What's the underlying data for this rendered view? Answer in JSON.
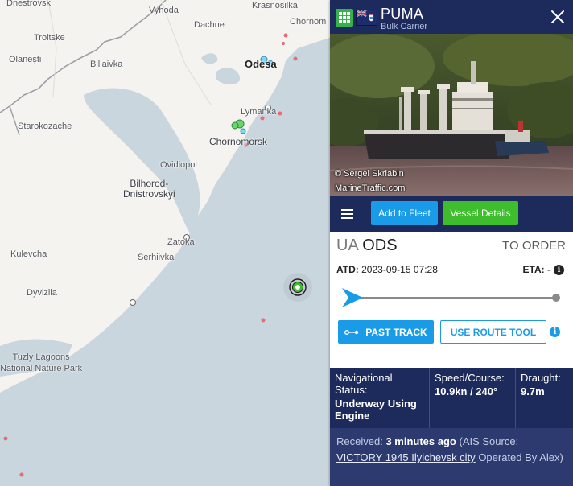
{
  "map": {
    "labels": {
      "odesa": "Odesa",
      "chornomorsk": "Chornomorsk",
      "lymanka": "Lymanka",
      "ovidiopol": "Ovidiopol",
      "bilhorod": "Bilhorod-\nDnistrovskyi",
      "zatoka": "Zatoka",
      "serhiivka": "Serhiivka",
      "kulevcha": "Kulevcha",
      "dyviziia": "Dyviziia",
      "tuzly": "Tuzly Lagoons\nNational Nature Park",
      "starokozache": "Starokozache",
      "biliaivka": "Biliaivka",
      "olanesti": "Olanești",
      "troitske": "Troitske",
      "dachne": "Dachne",
      "vyhoda": "Vyhoda",
      "krasnosilka": "Krasnosilka",
      "chornomorske": "Chornom",
      "dnestrovsk": "Dnestrovsk"
    }
  },
  "panel": {
    "vessel_name": "PUMA",
    "vessel_type": "Bulk Carrier",
    "photo_credit_line1": "© Sergei Skriabin",
    "photo_credit_line2": "MarineTraffic.com",
    "add_to_fleet": "Add to Fleet",
    "vessel_details": "Vessel Details",
    "origin_country": "UA",
    "origin_port": "ODS",
    "destination": "TO ORDER",
    "atd_label": "ATD:",
    "atd_value": "2023-09-15 07:28",
    "eta_label": "ETA:",
    "eta_value": "-",
    "voyage_progress": 0,
    "past_track": "PAST TRACK",
    "use_route_tool": "USE ROUTE TOOL",
    "nav_status_label": "Navigational Status:",
    "nav_status_value": "Underway Using Engine",
    "speed_label": "Speed/Course:",
    "speed_value": "10.9kn / 240°",
    "draught_label": "Draught:",
    "draught_value": "9.7m",
    "received_label": "Received:",
    "received_value": "3 minutes ago",
    "ais_prefix": "(AIS Source:",
    "ais_source": "VICTORY 1945 Ilyichevsk city",
    "ais_suffix": "Operated By Alex)"
  },
  "colors": {
    "panel_dark": "#1c2a5c",
    "accent_blue": "#1a9be8",
    "accent_green": "#3ebe2c",
    "sea": "#c9d6de",
    "land": "#f5f3ef"
  },
  "icons": [
    "grid-icon",
    "flag-icon",
    "close-icon",
    "menu-icon",
    "info-icon",
    "track-icon",
    "ship-marker-icon"
  ]
}
